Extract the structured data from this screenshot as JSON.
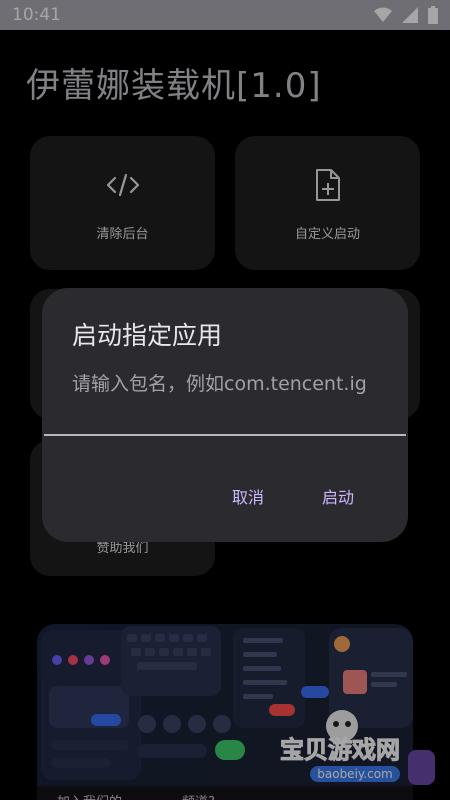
{
  "status_bar": {
    "time": "10:41"
  },
  "app": {
    "title": "伊蕾娜装载机[1.0]"
  },
  "cards": [
    {
      "label": "清除后台",
      "icon": "code-icon"
    },
    {
      "label": "自定义启动",
      "icon": "file-plus-icon"
    },
    {
      "label": "",
      "icon": ""
    },
    {
      "label": "",
      "icon": ""
    },
    {
      "label": "赞助我们",
      "icon": ""
    }
  ],
  "banner": {
    "left_text": "加入我们的",
    "right_text": "频道?"
  },
  "watermark": {
    "line1": "宝贝游戏网",
    "line2": "baobeiy.com"
  },
  "dialog": {
    "title": "启动指定应用",
    "input_placeholder": "请输入包名，例如com.tencent.ig",
    "cancel_label": "取消",
    "confirm_label": "启动"
  },
  "colors": {
    "accent": "#cdb8ff",
    "dialog_bg": "#2b2a2e",
    "card_bg": "#1f1f1f"
  }
}
